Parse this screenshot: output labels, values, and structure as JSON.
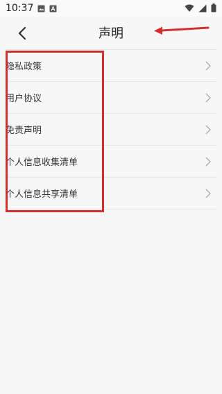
{
  "status_bar": {
    "time": "10:37",
    "icons": [
      "image-icon",
      "app-icon"
    ],
    "system_icons": [
      "wifi-icon",
      "signal-icon",
      "battery-icon"
    ]
  },
  "header": {
    "title": "声明",
    "back_icon": "chevron-left-icon"
  },
  "list": {
    "items": [
      {
        "label": "隐私政策"
      },
      {
        "label": "用户协议"
      },
      {
        "label": "免责声明"
      },
      {
        "label": "个人信息收集清单"
      },
      {
        "label": "个人信息共享清单"
      }
    ]
  },
  "annotations": {
    "highlight_color": "#d32f2f",
    "arrow_color": "#d32f2f"
  }
}
